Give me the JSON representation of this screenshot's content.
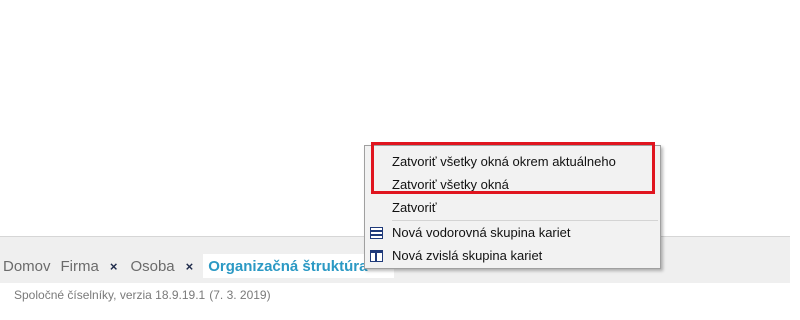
{
  "tabs": {
    "items": [
      {
        "label": "Domov",
        "closable": false,
        "active": false
      },
      {
        "label": "Firma",
        "closable": true,
        "active": false
      },
      {
        "label": "Osoba",
        "closable": true,
        "active": false
      },
      {
        "label": "Organizačná štruktúra",
        "closable": false,
        "active": true
      }
    ],
    "close_glyph": "×"
  },
  "status": {
    "text": "Spoločné číselníky, verzia 18.9.19.1",
    "date": "(7. 3. 2019)"
  },
  "context_menu": {
    "items": [
      {
        "label": "Zatvoriť všetky okná okrem aktuálneho",
        "icon": null
      },
      {
        "label": "Zatvoriť všetky okná",
        "icon": null
      },
      {
        "label": "Zatvoriť",
        "icon": null
      },
      {
        "label": "Nová vodorovná skupina kariet",
        "icon": "horizontal-tab-group-icon"
      },
      {
        "label": "Nová zvislá skupina kariet",
        "icon": "vertical-tab-group-icon"
      }
    ]
  },
  "colors": {
    "active_tab_text": "#2b99c4",
    "highlight": "#e0151f",
    "icon": "#1f3a7a"
  }
}
